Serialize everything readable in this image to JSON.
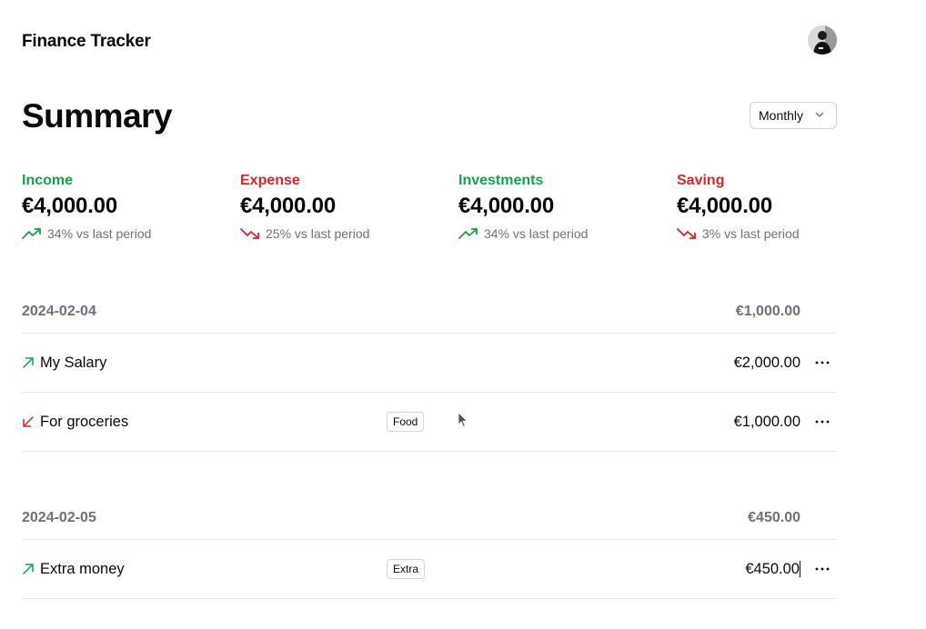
{
  "app": {
    "title": "Finance Tracker"
  },
  "summary": {
    "title": "Summary",
    "period": {
      "selected": "Monthly"
    },
    "stats": [
      {
        "label": "Income",
        "value": "€4,000.00",
        "change": "34% vs last period",
        "trend": "up",
        "color": "#16a34a"
      },
      {
        "label": "Expense",
        "value": "€4,000.00",
        "change": "25% vs last period",
        "trend": "down",
        "color": "#dc2626"
      },
      {
        "label": "Investments",
        "value": "€4,000.00",
        "change": "34% vs last period",
        "trend": "up",
        "color": "#16a34a"
      },
      {
        "label": "Saving",
        "value": "€4,000.00",
        "change": "3% vs last period",
        "trend": "down",
        "color": "#dc2626"
      }
    ]
  },
  "groups": [
    {
      "date": "2024-02-04",
      "total": "€1,000.00",
      "transactions": [
        {
          "name": "My Salary",
          "tag": "",
          "amount": "€2,000.00",
          "direction": "income"
        },
        {
          "name": "For groceries",
          "tag": "Food",
          "amount": "€1,000.00",
          "direction": "expense"
        }
      ]
    },
    {
      "date": "2024-02-05",
      "total": "€450.00",
      "transactions": [
        {
          "name": "Extra money",
          "tag": "Extra",
          "amount": "€450.00",
          "direction": "income"
        }
      ]
    }
  ],
  "icons": {
    "trend_up": "trending-up-icon",
    "trend_down": "trending-down-icon",
    "income": "arrow-up-right-icon",
    "expense": "arrow-down-left-icon",
    "more": "ellipsis-icon",
    "chevron": "chevron-down-icon"
  }
}
